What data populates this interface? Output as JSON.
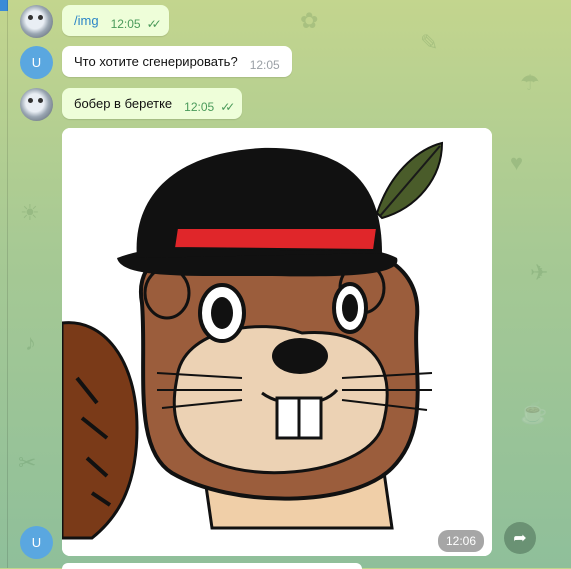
{
  "messages": [
    {
      "sender": "user",
      "text": "/img",
      "time": "12:05",
      "read_icon": "double-check-icon"
    },
    {
      "sender": "bot",
      "avatar_letter": "U",
      "text": "Что хотите сгенерировать?",
      "time": "12:05"
    },
    {
      "sender": "user",
      "text": "бобер в беретке",
      "time": "12:05",
      "read_icon": "double-check-icon"
    }
  ],
  "image_message": {
    "avatar_letter": "U",
    "time": "12:06",
    "image_subject": "beaver in a bowler hat with feather",
    "forward_icon": "share-arrow-icon"
  },
  "colors": {
    "background_top": "#c3d58e",
    "background_bottom": "#8fbf9a",
    "outgoing_bubble": "#eefed9",
    "incoming_bubble": "#ffffff",
    "link": "#2b85c7",
    "read_checks": "#4a9a5a",
    "bot_avatar": "#5aa7e0"
  }
}
